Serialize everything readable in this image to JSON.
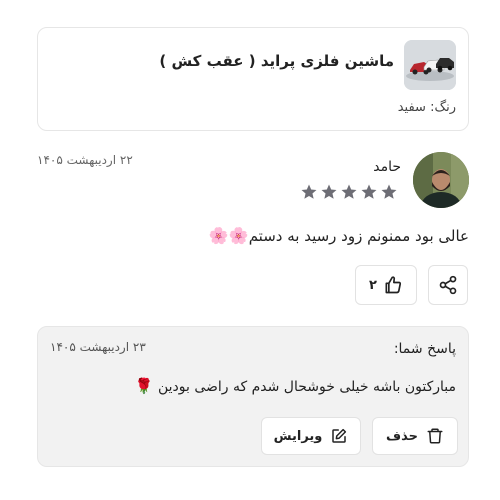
{
  "product": {
    "title": "ماشین فلزی پراید ( عقب کش )",
    "color_line": "رنگ: سفید",
    "thumbnail_icon": "toy-cars-image"
  },
  "review": {
    "author": "حامد",
    "date": "۲۲ اردیبهشت ۱۴۰۵",
    "rating": 5,
    "rating_max": 5,
    "text": "عالی بود ممنونم زود رسید به دستم",
    "emoji": "🌸",
    "like_count": "۲",
    "avatar_icon": "user-avatar"
  },
  "reply": {
    "label": "پاسخ شما:",
    "date": "۲۳ اردیبهشت ۱۴۰۵",
    "text": "مبارکتون باشه خیلی خوشحال شدم که راضی بودین",
    "emoji": "🌹",
    "delete_label": "حذف",
    "edit_label": "ویرایش"
  },
  "colors": {
    "star": "#6d6d75",
    "border": "#e6e6e6",
    "reply_bg": "#f2f2f2"
  }
}
